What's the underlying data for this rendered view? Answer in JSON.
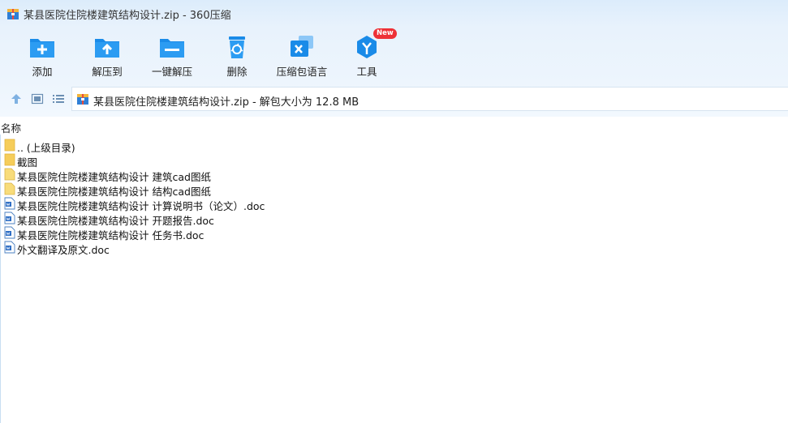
{
  "window": {
    "title": "某县医院住院楼建筑结构设计.zip - 360压缩"
  },
  "toolbar": {
    "items": [
      {
        "label": "添加",
        "icon": "add-icon"
      },
      {
        "label": "解压到",
        "icon": "extract-to-icon"
      },
      {
        "label": "一键解压",
        "icon": "one-click-extract-icon"
      },
      {
        "label": "删除",
        "icon": "delete-icon"
      },
      {
        "label": "压缩包语言",
        "icon": "language-icon"
      },
      {
        "label": "工具",
        "icon": "tools-icon"
      }
    ],
    "badge": "New"
  },
  "nav": {
    "path_text": "某县医院住院楼建筑结构设计.zip - 解包大小为 12.8 MB"
  },
  "columns": {
    "name": "名称"
  },
  "files": [
    {
      "name": ".. (上级目录)",
      "type": "folder"
    },
    {
      "name": "截图",
      "type": "folder"
    },
    {
      "name": "某县医院住院楼建筑结构设计 建筑cad图纸",
      "type": "file"
    },
    {
      "name": "某县医院住院楼建筑结构设计 结构cad图纸",
      "type": "file"
    },
    {
      "name": "某县医院住院楼建筑结构设计 计算说明书（论文）.doc",
      "type": "doc"
    },
    {
      "name": "某县医院住院楼建筑结构设计 开题报告.doc",
      "type": "doc"
    },
    {
      "name": "某县医院住院楼建筑结构设计 任务书.doc",
      "type": "doc"
    },
    {
      "name": "外文翻译及原文.doc",
      "type": "doc"
    }
  ],
  "colors": {
    "accent": "#1a8be8",
    "badge": "#ee3137",
    "folder": "#f6cd5a"
  }
}
